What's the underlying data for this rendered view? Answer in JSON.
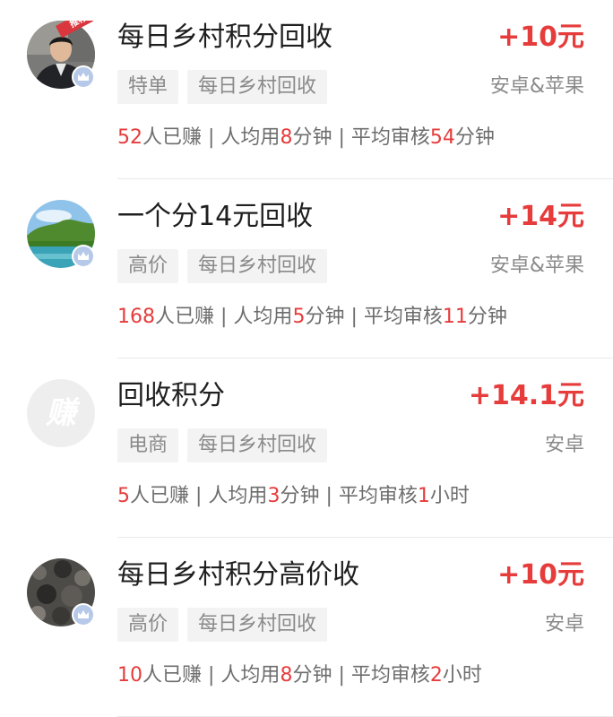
{
  "tasks": [
    {
      "avatar": "man-portrait-avatar",
      "corner_tag": "推荐",
      "title": "每日乡村积分回收",
      "reward": "+10元",
      "tags": [
        "特单",
        "每日乡村回收"
      ],
      "platform": "安卓&苹果",
      "stats": {
        "earned_count": "52",
        "earned_suffix": "人已赚",
        "sep1": " | ",
        "avg_prefix": "人均用",
        "avg_value": "8",
        "avg_suffix": "分钟",
        "sep2": " | ",
        "review_prefix": "平均审核",
        "review_value": "54",
        "review_suffix": "分钟"
      }
    },
    {
      "avatar": "landscape-avatar",
      "title": "一个分14元回收",
      "reward": "+14元",
      "tags": [
        "高价",
        "每日乡村回收"
      ],
      "platform": "安卓&苹果",
      "stats": {
        "earned_count": "168",
        "earned_suffix": "人已赚",
        "sep1": " | ",
        "avg_prefix": "人均用",
        "avg_value": "5",
        "avg_suffix": "分钟",
        "sep2": " | ",
        "review_prefix": "平均审核",
        "review_value": "11",
        "review_suffix": "分钟"
      }
    },
    {
      "avatar": "placeholder-avatar",
      "avatar_text": "赚",
      "title": "回收积分",
      "reward": "+14.1元",
      "tags": [
        "电商",
        "每日乡村回收"
      ],
      "platform": "安卓",
      "stats": {
        "earned_count": "5",
        "earned_suffix": "人已赚",
        "sep1": " | ",
        "avg_prefix": "人均用",
        "avg_value": "3",
        "avg_suffix": "分钟",
        "sep2": " | ",
        "review_prefix": "平均审核",
        "review_value": "1",
        "review_suffix": "小时"
      }
    },
    {
      "avatar": "texture-avatar",
      "title": "每日乡村积分高价收",
      "reward": "+10元",
      "tags": [
        "高价",
        "每日乡村回收"
      ],
      "platform": "安卓",
      "stats": {
        "earned_count": "10",
        "earned_suffix": "人已赚",
        "sep1": " | ",
        "avg_prefix": "人均用",
        "avg_value": "8",
        "avg_suffix": "分钟",
        "sep2": " | ",
        "review_prefix": "平均审核",
        "review_value": "2",
        "review_suffix": "小时"
      }
    }
  ],
  "colors": {
    "accent_red": "#e63c3c",
    "tag_bg": "#f3f3f3",
    "muted_text": "#8a8a8a",
    "badge_blue": "#b7c9e8"
  }
}
